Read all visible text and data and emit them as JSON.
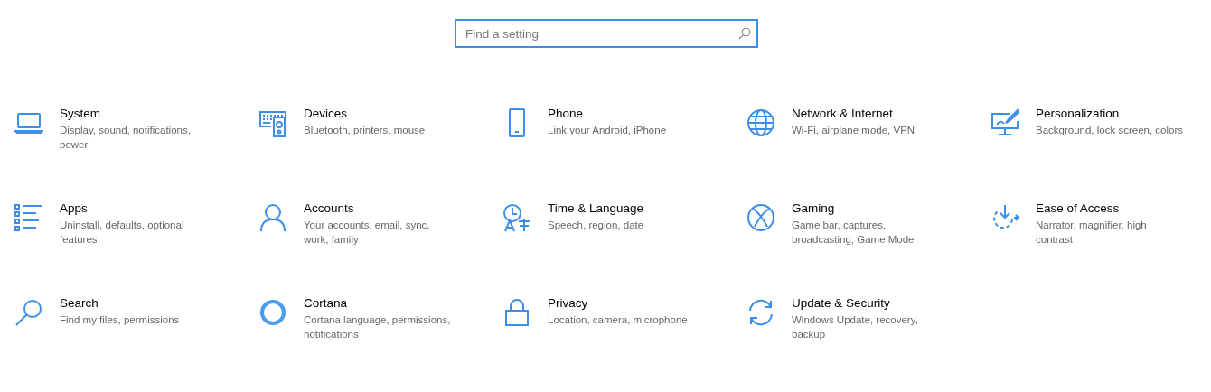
{
  "search": {
    "placeholder": "Find a setting",
    "focused": true
  },
  "categories": [
    {
      "kind": "laptop",
      "title": "System",
      "description": [
        "Display, sound, notifications,",
        "power"
      ]
    },
    {
      "kind": "keyboard-speaker",
      "title": "Devices",
      "description": [
        "Bluetooth, printers, mouse"
      ]
    },
    {
      "kind": "phone",
      "title": "Phone",
      "description": [
        "Link your Android, iPhone"
      ]
    },
    {
      "kind": "globe",
      "title": "Network & Internet",
      "description": [
        "Wi-Fi, airplane mode, VPN"
      ]
    },
    {
      "kind": "monitor-brush",
      "title": "Personalization",
      "description": [
        "Background, lock screen, colors"
      ]
    },
    {
      "kind": "list",
      "title": "Apps",
      "description": [
        "Uninstall, defaults, optional",
        "features"
      ]
    },
    {
      "kind": "person",
      "title": "Accounts",
      "description": [
        "Your accounts, email, sync,",
        "work, family"
      ]
    },
    {
      "kind": "clock",
      "title": "Time & Language",
      "description": [
        "Speech, region, date"
      ]
    },
    {
      "kind": "xbox",
      "title": "Gaming",
      "description": [
        "Game bar, captures,",
        "broadcasting, Game Mode"
      ]
    },
    {
      "kind": "dashed-circle",
      "title": "Ease of Access",
      "description": [
        "Narrator, magnifier, high",
        "contrast"
      ]
    },
    {
      "kind": "search",
      "title": "Search",
      "description": [
        "Find my files, permissions"
      ]
    },
    {
      "kind": "ring",
      "title": "Cortana",
      "description": [
        "Cortana language, permissions,",
        "notifications"
      ]
    },
    {
      "kind": "lock",
      "title": "Privacy",
      "description": [
        "Location, camera, microphone"
      ]
    },
    {
      "kind": "sync",
      "title": "Update & Security",
      "description": [
        "Windows Update, recovery,",
        "backup"
      ]
    }
  ]
}
